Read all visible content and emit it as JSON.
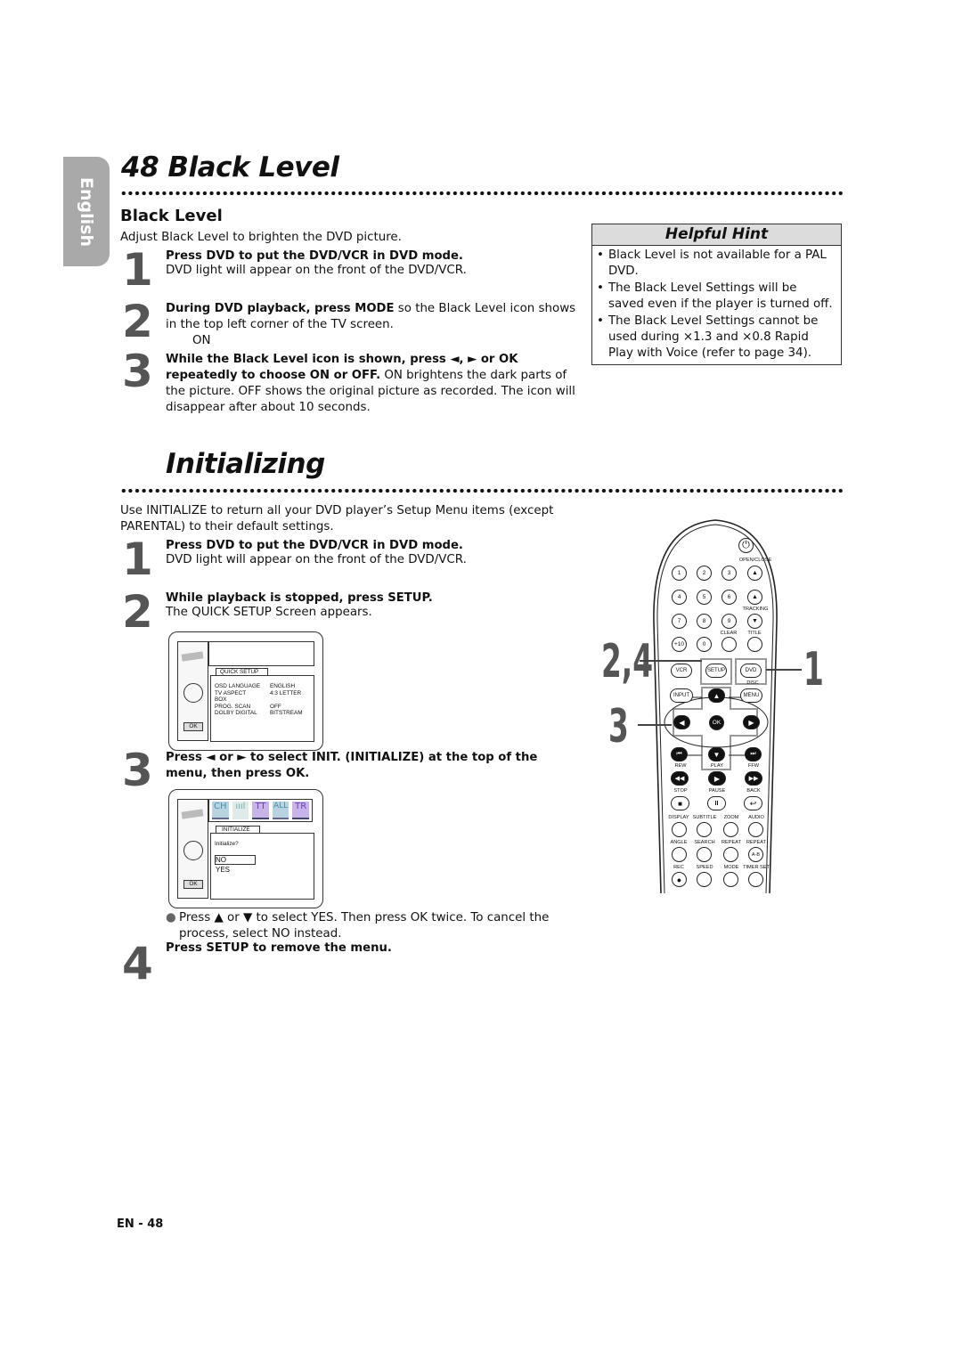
{
  "language_tab": "English",
  "black_level": {
    "page_title": "48 Black Level",
    "section_heading": "Black Level",
    "intro": "Adjust Black Level to brighten the DVD picture.",
    "steps": [
      {
        "num": "1",
        "title": "Press DVD to put the DVD/VCR in DVD mode.",
        "text": "DVD light will appear on the front of the DVD/VCR."
      },
      {
        "num": "2",
        "title": "During DVD playback, press MODE",
        "title_rest": " so the Black Level icon shows in the top left corner of the TV screen.",
        "indicator": "ON"
      },
      {
        "num": "3",
        "title": "While the Black Level icon is shown, press ◄, ► or OK repeatedly to choose ON or OFF.",
        "text": " ON brightens the dark parts of the picture. OFF shows the original picture as recorded. The icon will disappear after about 10 seconds."
      }
    ]
  },
  "helpful_hint": {
    "title": "Helpful Hint",
    "items": [
      "Black Level is not available for a PAL DVD.",
      "The Black Level Settings will be saved even if the player is turned off.",
      "The Black Level Settings cannot be used during ×1.3 and ×0.8 Rapid Play with Voice (refer to page 34)."
    ]
  },
  "initializing": {
    "page_title": "Initializing",
    "intro": "Use INITIALIZE to return all your DVD player’s Setup Menu items (except PARENTAL) to their default settings.",
    "steps": [
      {
        "num": "1",
        "title": "Press DVD to put the DVD/VCR in DVD mode.",
        "text": "DVD light will appear on the front of the DVD/VCR."
      },
      {
        "num": "2",
        "title": "While playback is stopped, press SETUP.",
        "text": "The QUICK SETUP Screen appears."
      },
      {
        "num": "3",
        "title": "Press ◄ or ► to select INIT. (INITIALIZE) at the top of the menu, then press OK."
      },
      {
        "num": "4",
        "title": "Press SETUP to remove the menu."
      }
    ],
    "bullet": "Press ▲ or ▼ to select YES. Then press OK twice. To cancel the process, select NO instead."
  },
  "quick_setup_screen": {
    "tab": "QUICK SETUP",
    "ok": "OK",
    "rows": [
      {
        "label": "OSD LANGUAGE",
        "value": "ENGLISH"
      },
      {
        "label": "TV ASPECT",
        "value": "4:3 LETTER BOX"
      },
      {
        "label": "PROG. SCAN",
        "value": "OFF"
      },
      {
        "label": "DOLBY DIGITAL",
        "value": "BITSTREAM"
      }
    ]
  },
  "initialize_screen": {
    "icons": [
      "CH",
      "ıııl",
      "TT",
      "ALL",
      "TR"
    ],
    "tab": "INITIALIZE",
    "question": "Initialize?",
    "options": [
      "NO",
      "YES"
    ],
    "selected": "NO",
    "ok": "OK"
  },
  "remote": {
    "callouts": {
      "setup": "2,4",
      "dvd": "1",
      "arrows": "3"
    },
    "labels": {
      "open_close": "OPEN/CLOSE",
      "tracking": "TRACKING",
      "clear": "CLEAR",
      "title": "TITLE",
      "disc": "DISC",
      "rew": "REW",
      "play": "PLAY",
      "ffw": "FFW",
      "stop": "STOP",
      "pause": "PAUSE",
      "back": "BACK",
      "display": "DISPLAY",
      "subtitle": "SUBTITLE",
      "zoom": "ZOOM",
      "audio": "AUDIO",
      "angle": "ANGLE",
      "search": "SEARCH",
      "repeat": "REPEAT",
      "repeat2": "REPEAT",
      "rec": "REC",
      "speed": "SPEED",
      "mode": "MODE",
      "timer_set": "TIMER SET"
    },
    "buttons": {
      "n1": "1",
      "n2": "2",
      "n3": "3",
      "n4": "4",
      "n5": "5",
      "n6": "6",
      "n7": "7",
      "n8": "8",
      "n9": "9",
      "plus10": "+10",
      "n0": "0",
      "vcr": "VCR",
      "setup": "SETUP",
      "dvd": "DVD",
      "input": "INPUT",
      "menu": "MENU",
      "ok": "OK",
      "ab": "A-B"
    }
  },
  "footer": {
    "page_number": "EN - 48"
  }
}
